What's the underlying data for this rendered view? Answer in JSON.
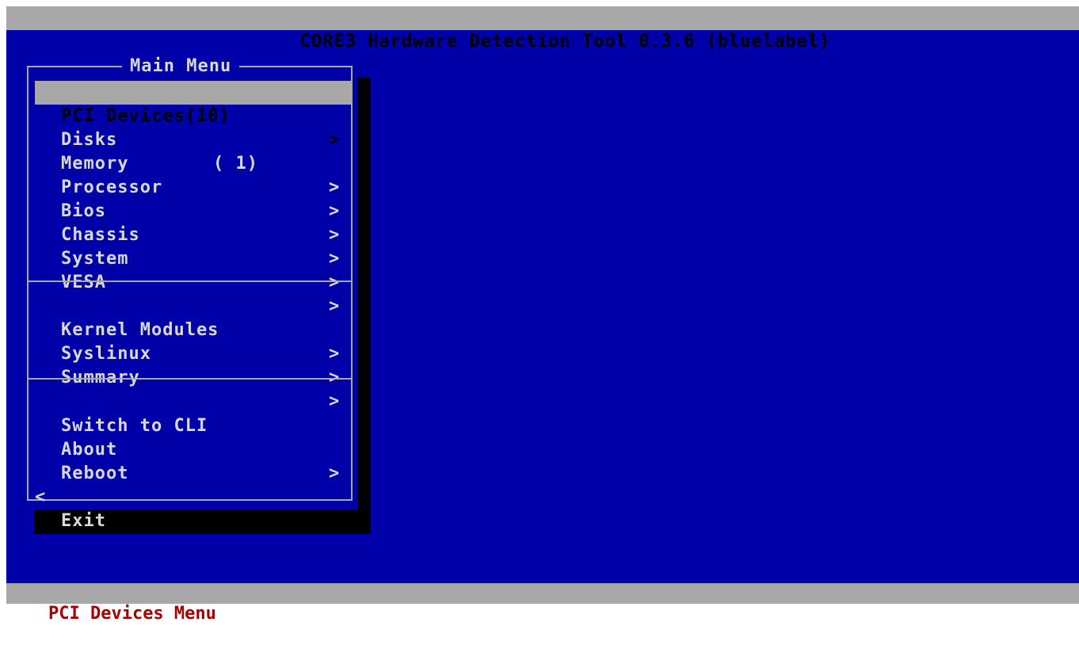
{
  "window": {
    "title": "CORE3 Hardware Detection Tool 0.3.6 (bluelabel)"
  },
  "menu": {
    "title": "Main Menu",
    "items": [
      {
        "label": "PCI Devices",
        "count": "(10)",
        "arrow": ">",
        "selected": true
      },
      {
        "label": "Disks",
        "count": "( 1)",
        "arrow": ">"
      },
      {
        "label": "Memory",
        "arrow": ">"
      },
      {
        "label": "Processor",
        "arrow": ">"
      },
      {
        "label": "Bios",
        "arrow": ">"
      },
      {
        "label": "Chassis",
        "arrow": ">"
      },
      {
        "label": "System",
        "arrow": ">"
      },
      {
        "label": "VESA",
        "arrow": ">"
      },
      {
        "label": "Kernel Modules",
        "arrow": ">"
      },
      {
        "label": "Syslinux",
        "arrow": ">"
      },
      {
        "label": "Summary",
        "arrow": ">"
      },
      {
        "label": "Switch to CLI"
      },
      {
        "label": "About",
        "arrow": ">"
      },
      {
        "label": "Reboot"
      },
      {
        "label": "Exit",
        "back_arrow": "<"
      }
    ]
  },
  "status_bar": {
    "text": "PCI Devices Menu"
  },
  "colors": {
    "background": "#0000a8",
    "bar": "#a8a8a8",
    "menu_text": "#d8d8d8",
    "status_text": "#a80000",
    "selected_bg": "#a8a8a8",
    "shadow": "#000000"
  }
}
